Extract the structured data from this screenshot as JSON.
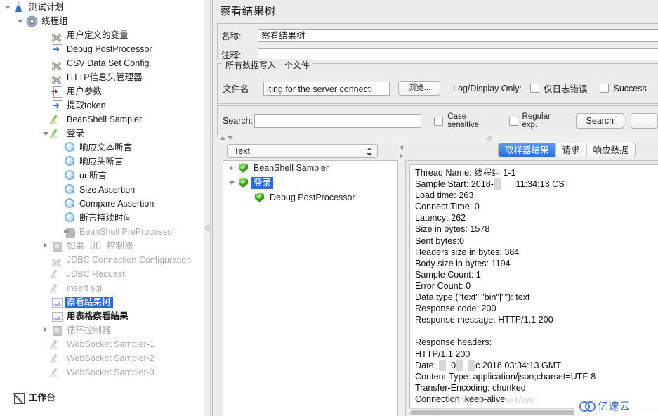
{
  "left_tree": {
    "nodes": [
      {
        "label": "测试计划",
        "depth": 0,
        "twist": "down",
        "icon": "flask-icon",
        "state": "normal"
      },
      {
        "label": "线程组",
        "depth": 1,
        "twist": "down",
        "icon": "gear-icon",
        "state": "normal"
      },
      {
        "label": "用户定义的变量",
        "depth": 2,
        "twist": "none",
        "icon": "tools-icon",
        "state": "normal"
      },
      {
        "label": "Debug PostProcessor",
        "depth": 2,
        "twist": "none",
        "icon": "page-arrow-icon",
        "state": "normal"
      },
      {
        "label": "CSV Data Set Config",
        "depth": 2,
        "twist": "none",
        "icon": "tools-icon",
        "state": "normal"
      },
      {
        "label": "HTTP信息头管理器",
        "depth": 2,
        "twist": "none",
        "icon": "tools-icon",
        "state": "normal"
      },
      {
        "label": "用户参数",
        "depth": 2,
        "twist": "none",
        "icon": "page-arrow-red-icon",
        "state": "normal"
      },
      {
        "label": "提取token",
        "depth": 2,
        "twist": "none",
        "icon": "page-arrow-icon",
        "state": "normal"
      },
      {
        "label": "BeanShell Sampler",
        "depth": 2,
        "twist": "none",
        "icon": "pen-icon",
        "state": "normal"
      },
      {
        "label": "登录",
        "depth": 2,
        "twist": "down",
        "icon": "pen-icon",
        "state": "normal"
      },
      {
        "label": "响应文本断言",
        "depth": 3,
        "twist": "none",
        "icon": "magnify-icon",
        "state": "normal"
      },
      {
        "label": "响应头断言",
        "depth": 3,
        "twist": "none",
        "icon": "magnify-icon",
        "state": "normal"
      },
      {
        "label": "url断言",
        "depth": 3,
        "twist": "none",
        "icon": "magnify-icon",
        "state": "normal"
      },
      {
        "label": "Size Assertion",
        "depth": 3,
        "twist": "none",
        "icon": "magnify-icon",
        "state": "normal"
      },
      {
        "label": "Compare Assertion",
        "depth": 3,
        "twist": "none",
        "icon": "magnify-icon",
        "state": "normal"
      },
      {
        "label": "断言持续时间",
        "depth": 3,
        "twist": "none",
        "icon": "magnify-icon",
        "state": "normal"
      },
      {
        "label": "BeanShell PreProcessor",
        "depth": 3,
        "twist": "none",
        "icon": "preprocessor-icon",
        "state": "disabled"
      },
      {
        "label": "如果（If）控制器",
        "depth": 2,
        "twist": "right",
        "icon": "controller-icon",
        "state": "disabled"
      },
      {
        "label": "JDBC Connection Configuration",
        "depth": 2,
        "twist": "none",
        "icon": "tools-gray-icon",
        "state": "disabled"
      },
      {
        "label": "JDBC Request",
        "depth": 2,
        "twist": "none",
        "icon": "pen-gray-icon",
        "state": "disabled"
      },
      {
        "label": "insert sql",
        "depth": 2,
        "twist": "none",
        "icon": "pen-gray-icon",
        "state": "disabled"
      },
      {
        "label": "察看结果树",
        "depth": 2,
        "twist": "none",
        "icon": "chart-icon",
        "state": "selected"
      },
      {
        "label": "用表格察看结果",
        "depth": 2,
        "twist": "none",
        "icon": "chart-icon",
        "state": "bold"
      },
      {
        "label": "循环控制器",
        "depth": 2,
        "twist": "right",
        "icon": "controller-icon",
        "state": "disabled"
      },
      {
        "label": "WebSocket Sampler-1",
        "depth": 2,
        "twist": "none",
        "icon": "pen-gray-icon",
        "state": "disabled"
      },
      {
        "label": "WebSocket Sampler-2",
        "depth": 2,
        "twist": "none",
        "icon": "pen-gray-icon",
        "state": "disabled"
      },
      {
        "label": "WebSocket Sampler-3",
        "depth": 2,
        "twist": "none",
        "icon": "pen-gray-icon",
        "state": "disabled"
      },
      {
        "label": "工作台",
        "depth": 0,
        "twist": "none",
        "icon": "workbench-icon",
        "state": "bold"
      }
    ]
  },
  "panel": {
    "title": "察看结果树",
    "name_label": "名称:",
    "name_value": "察看结果树",
    "comment_label": "注释:",
    "comment_value": "",
    "group_legend": "所有数据写入一个文件",
    "filename_label": "文件名",
    "filename_value": "iting for the server connecti",
    "browse_button": "浏览...",
    "log_display_label": "Log/Display Only:",
    "errors_only_label": "仅日志错误",
    "errors_only_checked": false,
    "successes_only_label": "Success",
    "successes_only_checked": false
  },
  "search": {
    "label": "Search:",
    "value": "",
    "case_sensitive_label": "Case sensitive",
    "case_sensitive_checked": false,
    "regular_exp_label": "Regular exp.",
    "regular_exp_checked": false,
    "search_button": "Search"
  },
  "renderer": {
    "selected": "Text"
  },
  "results_tree": {
    "nodes": [
      {
        "label": "BeanShell Sampler",
        "depth": 0,
        "twist": "right",
        "status": "success",
        "selected": false
      },
      {
        "label": "登录",
        "depth": 0,
        "twist": "down",
        "status": "success",
        "selected": true
      },
      {
        "label": "Debug PostProcessor",
        "depth": 1,
        "twist": "none",
        "status": "success",
        "selected": false
      }
    ]
  },
  "detail_tabs": {
    "items": [
      {
        "label": "取样器结果",
        "active": true
      },
      {
        "label": "请求",
        "active": false
      },
      {
        "label": "响应数据",
        "active": false
      }
    ]
  },
  "sampler_result": {
    "lines": [
      "Thread Name: 线程组 1-1",
      "Sample Start: 2018-\u0001      11:34:13 CST",
      "Load time: 263",
      "Connect Time: 0",
      "Latency: 262",
      "Size in bytes: 1578",
      "Sent bytes:0",
      "Headers size in bytes: 384",
      "Body size in bytes: 1194",
      "Sample Count: 1",
      "Error Count: 0",
      "Data type (\"text\"|\"bin\"|\"\"): text",
      "Response code: 200",
      "Response message: HTTP/1.1 200",
      "",
      "Response headers:",
      "HTTP/1.1 200",
      "Date: \u0001  0\u0001  \u0001c 2018 03:34:13 GMT",
      "Content-Type: application/json;charset=UTF-8",
      "Transfer-Encoding: chunked",
      "Connection: keep-alive"
    ],
    "fields": {
      "thread_name": "线程组 1-1",
      "sample_start": "2018- 11:34:13 CST",
      "load_time": "263",
      "connect_time": "0",
      "latency": "262",
      "size_in_bytes": "1578",
      "sent_bytes": "0",
      "headers_size_in_bytes": "384",
      "body_size_in_bytes": "1194",
      "sample_count": "1",
      "error_count": "0",
      "data_type": "text",
      "response_code": "200",
      "response_message": "HTTP/1.1 200",
      "response_headers_status": "HTTP/1.1 200",
      "date": "2018 03:34:13 GMT",
      "content_type": "application/json;charset=UTF-8",
      "transfer_encoding": "chunked",
      "connection": "keep-alive"
    }
  },
  "watermark": {
    "url": "https://blog.csdn.net/wei",
    "brand": "亿速云"
  },
  "colors": {
    "selection_blue": "#2f69d8",
    "tab_active_blue": "#2f6fe0",
    "panel_bg": "#ececec",
    "disabled_text": "#a8a8a8"
  }
}
